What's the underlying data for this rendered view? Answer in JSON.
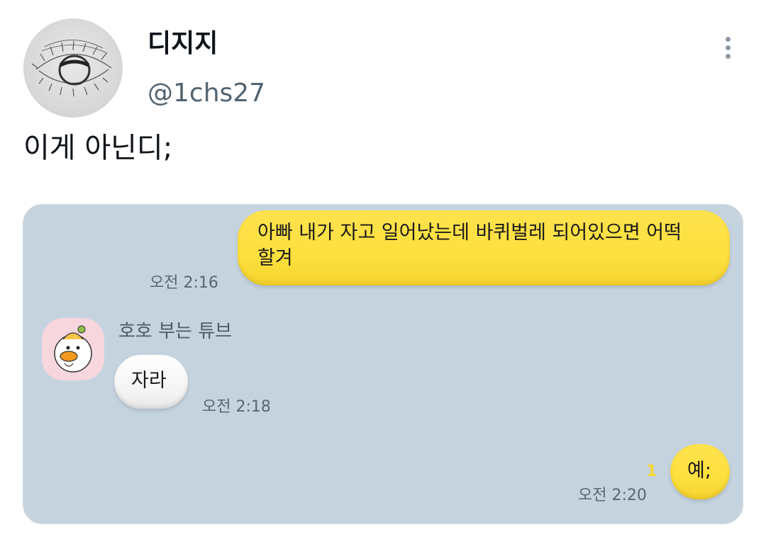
{
  "tweet": {
    "display_name": "디지지",
    "handle": "@1chs27",
    "text": "이게 아닌디;",
    "avatar_icon": "eye-sketch-icon",
    "more_icon": "more-vertical-icon"
  },
  "chat": {
    "background_color": "#c5d3df",
    "my_bubble_color": "#fde03e",
    "their_bubble_color": "#ffffff",
    "messages": [
      {
        "sender": "me",
        "text_line1": "아빠 내가 자고 일어났는데 바퀴벌레 되어있으면 어떡",
        "text_line2": "할겨",
        "time": "오전 2:16"
      },
      {
        "sender": "호호 부는 튜브",
        "text": "자라",
        "time": "오전 2:18"
      },
      {
        "sender": "me",
        "text": "예;",
        "time": "오전 2:20",
        "unread_count": "1"
      }
    ],
    "friend_avatar_icon": "tube-duck-icon"
  }
}
